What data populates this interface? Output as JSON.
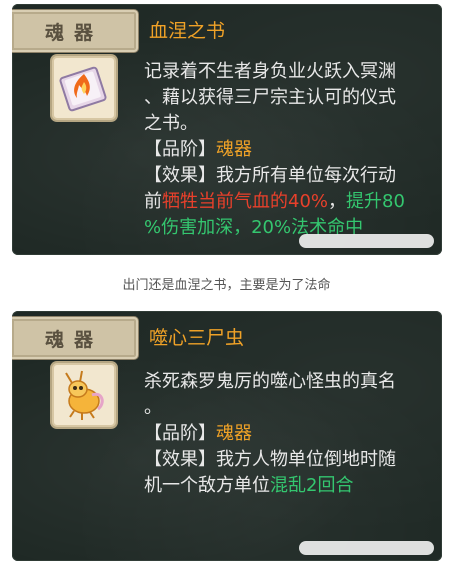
{
  "card1": {
    "category": "魂器",
    "title": "血涅之书",
    "desc_lines": [
      "记录着不生者身负业火跃入冥渊",
      "、藉以获得三尸宗主认可的仪式",
      "之书。"
    ],
    "grade_label": "【品阶】",
    "grade_value": "魂器",
    "effect_label": "【效果】",
    "effect_text_1": "我方所有单位每次行动",
    "effect_prefix_2": "前",
    "effect_red": "牺牲当前气血的40%",
    "effect_sep": "，",
    "effect_green_1": "提升80",
    "effect_green_2": "%伤害加深，20%法术命中"
  },
  "caption": "出门还是血涅之书，主要是为了法命",
  "card2": {
    "category": "魂器",
    "title": "噬心三尸虫",
    "desc_lines": [
      "杀死森罗鬼厉的噬心怪虫的真名",
      "。"
    ],
    "grade_label": "【品阶】",
    "grade_value": "魂器",
    "effect_label": "【效果】",
    "effect_text_1": "我方人物单位倒地时随",
    "effect_prefix_2": "机一个敌方单位",
    "effect_green": "混乱2回合"
  },
  "colors": {
    "panel": "#1f2925",
    "title": "#f0a227",
    "highlight_red": "#e8402b",
    "highlight_green": "#34c66f"
  },
  "icons": [
    "book-fire-item-icon",
    "soul-bug-item-icon"
  ]
}
